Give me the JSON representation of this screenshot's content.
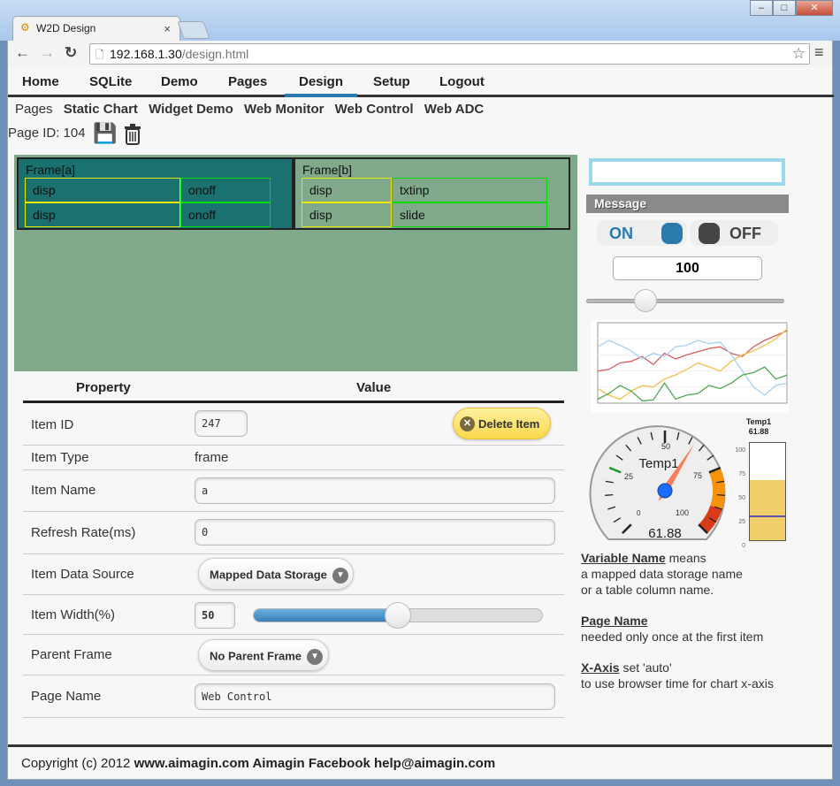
{
  "browser": {
    "tab_title": "W2D Design",
    "url_host": "192.168.1.30",
    "url_path": "/design.html"
  },
  "nav": {
    "items": [
      "Home",
      "SQLite",
      "Demo",
      "Pages",
      "Design",
      "Setup",
      "Logout"
    ],
    "active": "Design"
  },
  "subnav": {
    "label": "Pages",
    "items": [
      "Static Chart",
      "Widget Demo",
      "Web Monitor",
      "Web Control",
      "Web ADC"
    ]
  },
  "page_id": {
    "label": "Page ID: 104"
  },
  "designer": {
    "frame_a": {
      "title": "Frame[a]",
      "cells": [
        [
          "disp",
          "onoff"
        ],
        [
          "disp",
          "onoff"
        ]
      ]
    },
    "frame_b": {
      "title": "Frame[b]",
      "cells": [
        [
          "disp",
          "txtinp"
        ],
        [
          "disp",
          "slide"
        ]
      ]
    }
  },
  "widgets": {
    "message_label": "Message",
    "on_label": "ON",
    "off_label": "OFF",
    "number_value": "100",
    "slider_value": 30,
    "gauge": {
      "title": "Temp1",
      "value": "61.88",
      "ticks": [
        "0",
        "25",
        "50",
        "75",
        "100"
      ]
    },
    "bar": {
      "title": "Temp1",
      "value": "61.88",
      "ticks": [
        "100",
        "75",
        "50",
        "25",
        "0"
      ],
      "fill": 61.88,
      "marker": 24
    },
    "colors": {
      "accent": "#2a7aad",
      "frame_a": "#1b7070",
      "canvas": "#7fa98a",
      "button": "#fde26a"
    }
  },
  "chart_data": {
    "type": "line",
    "ylim": [
      0,
      100
    ],
    "series": [
      {
        "color": "#d85c5c",
        "values": [
          40,
          42,
          50,
          52,
          58,
          48,
          62,
          55,
          60,
          64,
          68,
          70,
          62,
          58,
          70,
          78,
          84,
          90
        ]
      },
      {
        "color": "#f0c050",
        "values": [
          18,
          10,
          5,
          15,
          22,
          20,
          30,
          35,
          42,
          50,
          45,
          40,
          52,
          60,
          65,
          72,
          80,
          92
        ]
      },
      {
        "color": "#a8d0f0",
        "values": [
          70,
          78,
          72,
          65,
          55,
          62,
          58,
          70,
          72,
          78,
          74,
          76,
          60,
          40,
          20,
          10,
          22,
          25
        ]
      },
      {
        "color": "#50a850",
        "values": [
          5,
          12,
          22,
          15,
          3,
          4,
          25,
          5,
          10,
          12,
          22,
          18,
          25,
          35,
          38,
          45,
          30,
          35
        ]
      }
    ]
  },
  "properties": {
    "header_property": "Property",
    "header_value": "Value",
    "item_id": {
      "label": "Item ID",
      "value": "247"
    },
    "delete_label": "Delete Item",
    "item_type": {
      "label": "Item Type",
      "value": "frame"
    },
    "item_name": {
      "label": "Item Name",
      "value": "a"
    },
    "refresh": {
      "label": "Refresh Rate(ms)",
      "value": "0"
    },
    "data_source": {
      "label": "Item Data Source",
      "value": "Mapped Data Storage"
    },
    "width": {
      "label": "Item Width(%)",
      "value": "50",
      "percent": 50
    },
    "parent": {
      "label": "Parent Frame",
      "value": "No Parent Frame"
    },
    "page_name": {
      "label": "Page Name",
      "value": "Web Control"
    }
  },
  "help": {
    "var_title": "Variable Name",
    "var_rest": " means",
    "var_l2": "a mapped data storage name",
    "var_l3": "or a table column name.",
    "page_title": "Page Name",
    "page_l2": "needed only once at the first item",
    "x_title": "X-Axis",
    "x_rest": " set 'auto'",
    "x_l2": "to use browser time for chart x-axis"
  },
  "footer": {
    "prefix": "Copyright (c) 2012 ",
    "bold": "www.aimagin.com Aimagin Facebook help@aimagin.com"
  }
}
